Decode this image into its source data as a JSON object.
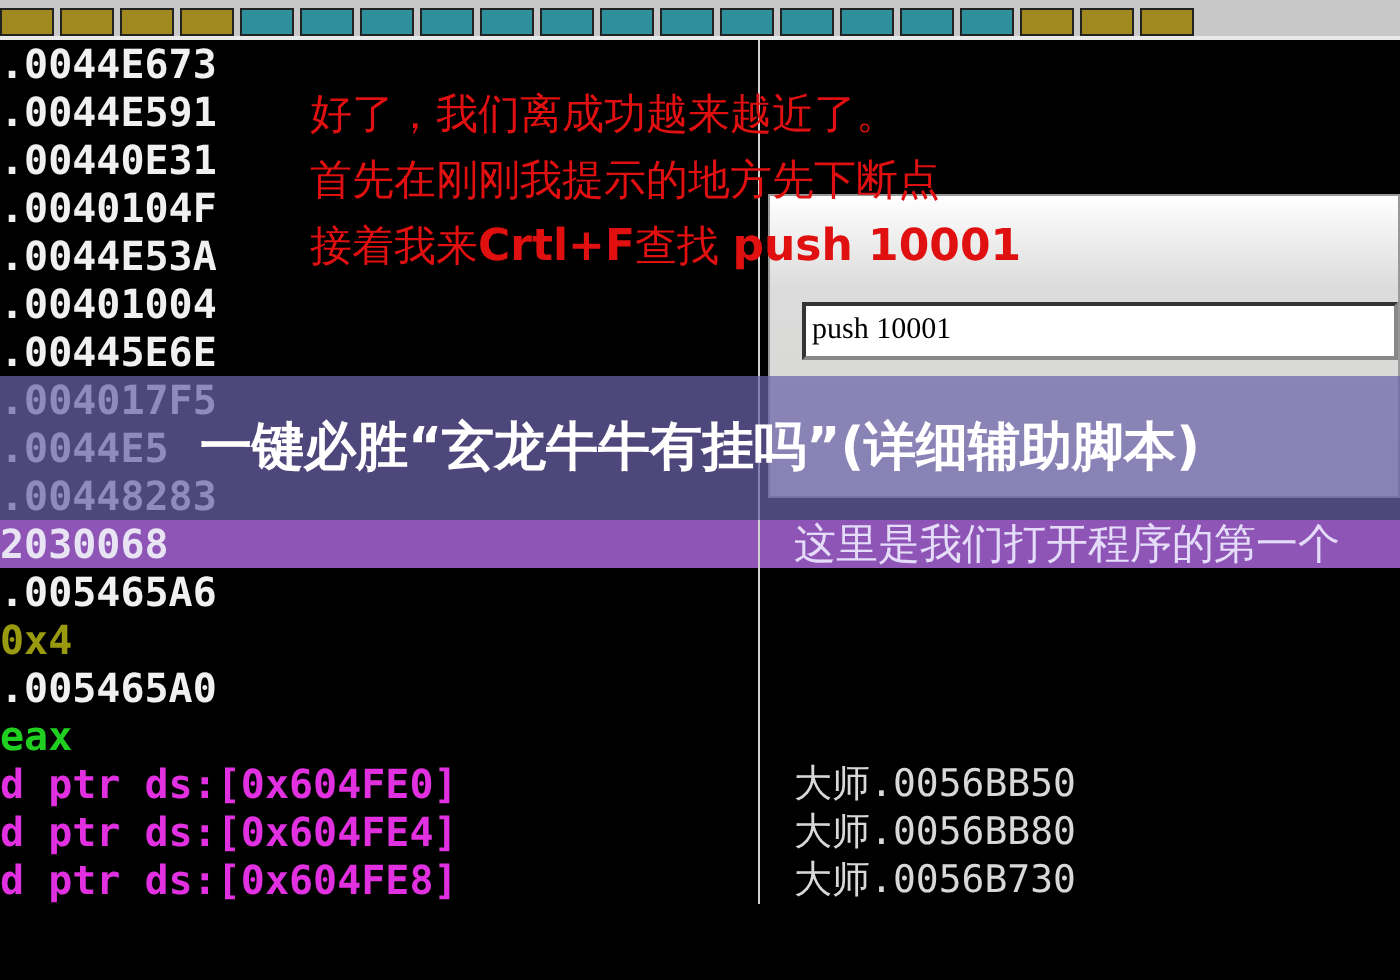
{
  "rows": [
    {
      "code": ".0044E673",
      "kind": "address",
      "selected": false
    },
    {
      "code": ".0044E591",
      "kind": "address",
      "selected": false
    },
    {
      "code": ".00440E31",
      "kind": "address",
      "selected": false
    },
    {
      "code": ".0040104F",
      "kind": "address",
      "selected": false
    },
    {
      "code": ".0044E53A",
      "kind": "address",
      "selected": false
    },
    {
      "code": ".00401004",
      "kind": "address",
      "selected": false
    },
    {
      "code": ".00445E6E",
      "kind": "address",
      "selected": false
    },
    {
      "code": ".004017F5",
      "kind": "address",
      "selected": false
    },
    {
      "code": ".0044E5",
      "kind": "address",
      "selected": false
    },
    {
      "code": ".00448283",
      "kind": "address",
      "selected": false
    },
    {
      "code": "2030068",
      "kind": "address",
      "selected": true,
      "comment": "这里是我们打开程序的第一个"
    },
    {
      "code": ".005465A6",
      "kind": "address",
      "selected": false
    },
    {
      "code": "0x4",
      "kind": "constant",
      "selected": false
    },
    {
      "code": ".005465A0",
      "kind": "address",
      "selected": false
    },
    {
      "code": "eax",
      "kind": "register",
      "selected": false
    },
    {
      "code": "d ptr ds:[0x604FE0]",
      "kind": "memory",
      "selected": false,
      "comment": "大师.0056BB50"
    },
    {
      "code": "d ptr ds:[0x604FE4]",
      "kind": "memory",
      "selected": false,
      "comment": "大师.0056BB80"
    },
    {
      "code": "d ptr ds:[0x604FE8]",
      "kind": "memory",
      "selected": false,
      "comment": "大师.0056B730"
    }
  ],
  "annotation": [
    "好了，我们离成功越来越近了。",
    "首先在刚刚我提示的地方先下断点",
    "接着我来**Crtl+F**查找 **push 10001**"
  ],
  "find_dialog": {
    "value": "push 10001"
  },
  "banner": {
    "title": "一键必胜“玄龙牛牛有挂吗”(详细辅助脚本)"
  }
}
